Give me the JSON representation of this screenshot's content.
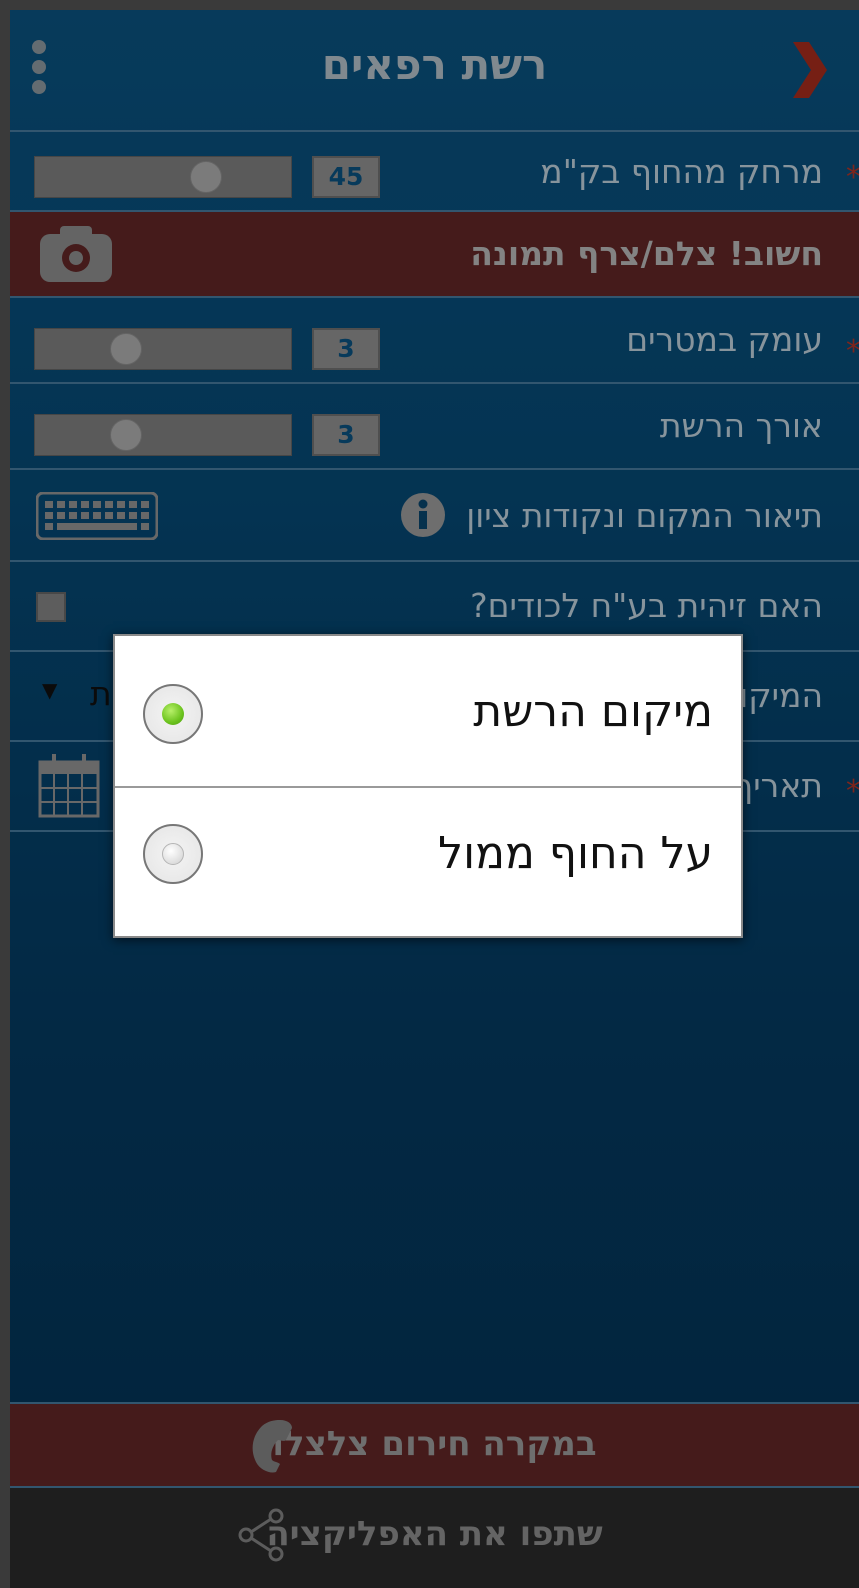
{
  "header": {
    "title": "רשת רפאים",
    "back_icon": "chevron-right-icon",
    "menu_icon": "more-vertical-icon"
  },
  "colors": {
    "accent_red": "#c0392b",
    "header_bg": "#0b5a8c",
    "banner_red": "#6a2a2a",
    "share_bar": "#2e2e2e"
  },
  "form": {
    "distance": {
      "label": "מרחק מהחוף בק\"מ",
      "value": "45",
      "required": "*",
      "slider_fraction": 0.7
    },
    "photo": {
      "label": "חשוב! צלם/צרף תמונה",
      "icon": "camera-icon"
    },
    "depth": {
      "label": "עומק במטרים",
      "value": "3",
      "required": "*",
      "slider_fraction": 0.33
    },
    "length": {
      "label": "אורך הרשת",
      "value": "3",
      "slider_fraction": 0.33
    },
    "description": {
      "label": "תיאור המקום ונקודות ציון",
      "info_icon": "info-icon",
      "keyboard_icon": "keyboard-icon"
    },
    "previous_identified": {
      "label": "האם זיהית בע\"ח לכודים?",
      "checked": false
    },
    "location": {
      "label": "המיקום",
      "value": "ת",
      "required": ""
    },
    "date": {
      "label": "תאריך",
      "required": "*",
      "calendar_icon": "calendar-icon"
    }
  },
  "dialog": {
    "options": [
      {
        "label": "מיקום הרשת",
        "selected": true
      },
      {
        "label": "על החוף ממול",
        "selected": false
      }
    ]
  },
  "footer": {
    "emergency_label": "במקרה חירום צלצלו",
    "phone_icon": "phone-icon",
    "share_label": "שתפו את האפליקציה",
    "share_icon": "share-icon"
  }
}
